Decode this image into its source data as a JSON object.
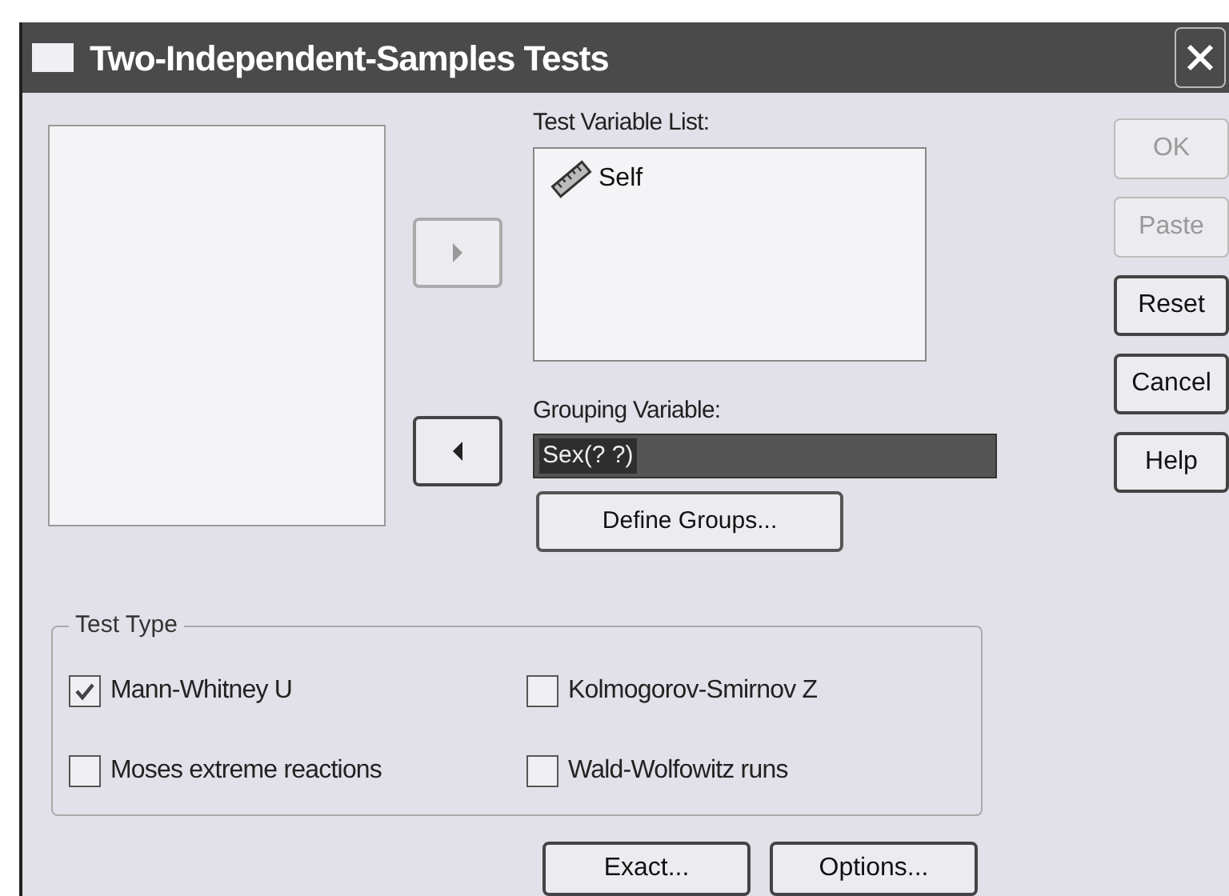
{
  "window": {
    "title": "Two-Independent-Samples Tests"
  },
  "move_buttons": [
    {
      "kind": "right",
      "disabled": true
    },
    {
      "kind": "left",
      "disabled": false
    }
  ],
  "test_variable_list": {
    "label": "Test Variable List:",
    "items": [
      {
        "name": "Self"
      }
    ]
  },
  "grouping_variable": {
    "label": "Grouping Variable:",
    "value": "Sex(? ?)"
  },
  "define_groups_button": {
    "label": "Define Groups...",
    "disabled": false
  },
  "side_buttons": [
    {
      "label": "OK",
      "disabled": true
    },
    {
      "label": "Paste",
      "disabled": true
    },
    {
      "label": "Reset",
      "disabled": false
    },
    {
      "label": "Cancel",
      "disabled": false
    },
    {
      "label": "Help",
      "disabled": false
    }
  ],
  "test_type": {
    "label": "Test Type",
    "options": [
      {
        "label": "Mann-Whitney U",
        "checked": true
      },
      {
        "label": "Kolmogorov-Smirnov Z",
        "checked": false
      },
      {
        "label": "Moses extreme reactions",
        "checked": false
      },
      {
        "label": "Wald-Wolfowitz runs",
        "checked": false
      }
    ]
  },
  "bottom_buttons": [
    {
      "label": "Exact...",
      "disabled": false
    },
    {
      "label": "Options...",
      "disabled": false
    }
  ]
}
